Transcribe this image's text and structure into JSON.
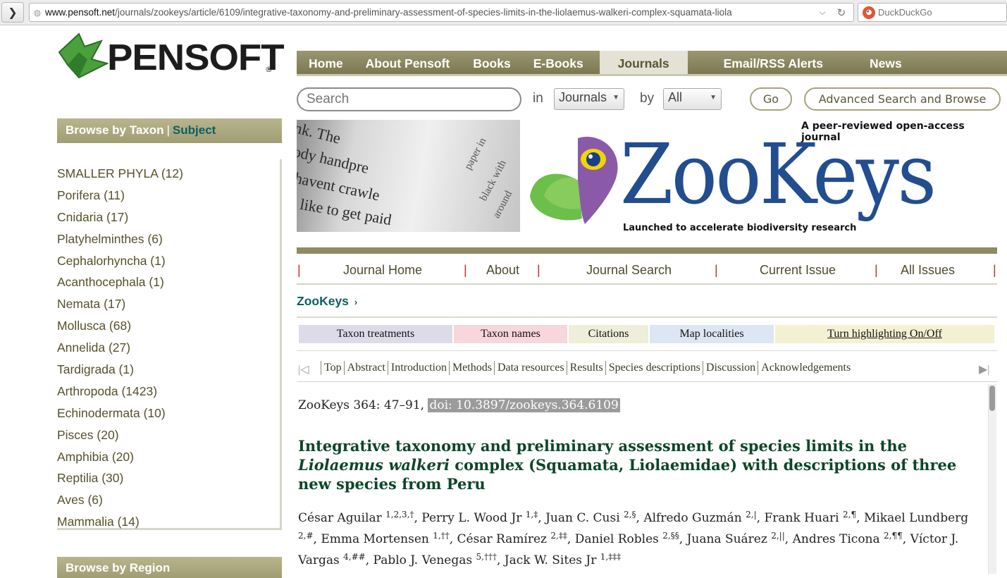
{
  "browser": {
    "url_domain": "www.pensoft.net",
    "url_path": "/journals/zookeys/article/6109/integrative-taxonomy-and-preliminary-assessment-of-species-limits-in-the-liolaemus-walkeri-complex-squamata-liola",
    "search_engine": "DuckDuckGo"
  },
  "logo": {
    "text": "PENSOFT",
    "reg": "®",
    "accent": "#4aa03c"
  },
  "sidebar": {
    "browse_by": "Browse  by  Taxon",
    "separator": "|",
    "subject": "Subject",
    "taxa": [
      "SMALLER PHYLA (12)",
      "Porifera (11)",
      "Cnidaria (17)",
      "Platyhelminthes (6)",
      "Cephalorhyncha (1)",
      "Acanthocephala (1)",
      "Nemata (17)",
      "Mollusca (68)",
      "Annelida (27)",
      "Tardigrada (1)",
      "Arthropoda (1423)",
      "Echinodermata (10)",
      "Pisces (20)",
      "Amphibia (20)",
      "Reptilia (30)",
      "Aves (6)",
      "Mammalia (14)"
    ],
    "browse_region": "Browse by Region"
  },
  "main_nav": [
    "Home",
    "About Pensoft",
    "Books",
    "E-Books",
    "Journals",
    "Email/RSS Alerts",
    "News"
  ],
  "main_nav_active": "Journals",
  "search": {
    "placeholder": "Search",
    "in_label": "in",
    "in_value": "Journals",
    "by_label": "by",
    "by_value": "All",
    "go": "Go",
    "advanced": "Advanced Search and Browse"
  },
  "banner": {
    "book_text": [
      "nk. The",
      "ody handpre",
      "havent crawle",
      "like to get paid",
      "paper in",
      "black with",
      "around"
    ],
    "tagline": "A peer-reviewed open-access journal",
    "journal_name": "ZooKeys",
    "subtitle": "Launched to accelerate biodiversity research",
    "brand_blue": "#224e8f"
  },
  "journal_nav": [
    "Journal Home",
    "About",
    "Journal Search",
    "Current Issue",
    "All Issues"
  ],
  "breadcrumb": "ZooKeys",
  "highlight": {
    "taxon_treatments": "Taxon treatments",
    "taxon_names": "Taxon names",
    "citations": "Citations",
    "map_localities": "Map localities",
    "toggle": "Turn highlighting On/Off"
  },
  "sections": [
    "Top",
    "Abstract",
    "Introduction",
    "Methods",
    "Data resources",
    "Results",
    "Species descriptions",
    "Discussion",
    "Acknowledgements"
  ],
  "article": {
    "citation": "ZooKeys 364: 47–91, ",
    "doi": "doi: 10.3897/zookeys.364.6109",
    "title_1": "Integrative taxonomy and preliminary assessment of species limits in the",
    "title_italic": "Liolaemus walkeri",
    "title_2": " complex (Squamata, Liolaemidae) with descriptions of three new species from Peru",
    "authors": [
      {
        "name": "César Aguilar",
        "sup": "1,2,3,†"
      },
      {
        "name": "Perry L. Wood Jr",
        "sup": "1,‡"
      },
      {
        "name": "Juan C. Cusi",
        "sup": "2,§"
      },
      {
        "name": "Alfredo Guzmán",
        "sup": "2,|"
      },
      {
        "name": "Frank Huari",
        "sup": "2,¶"
      },
      {
        "name": "Mikael Lundberg",
        "sup": "2,#"
      },
      {
        "name": "Emma Mortensen",
        "sup": "1,††"
      },
      {
        "name": "César Ramírez",
        "sup": "2,‡‡"
      },
      {
        "name": "Daniel Robles",
        "sup": "2,§§"
      },
      {
        "name": "Juana Suárez",
        "sup": "2,||"
      },
      {
        "name": "Andres Ticona",
        "sup": "2,¶¶"
      },
      {
        "name": "Víctor J. Vargas",
        "sup": "4,##"
      },
      {
        "name": "Pablo J. Venegas",
        "sup": "5,†††"
      },
      {
        "name": "Jack W. Sites Jr",
        "sup": "1,‡‡‡"
      }
    ]
  }
}
